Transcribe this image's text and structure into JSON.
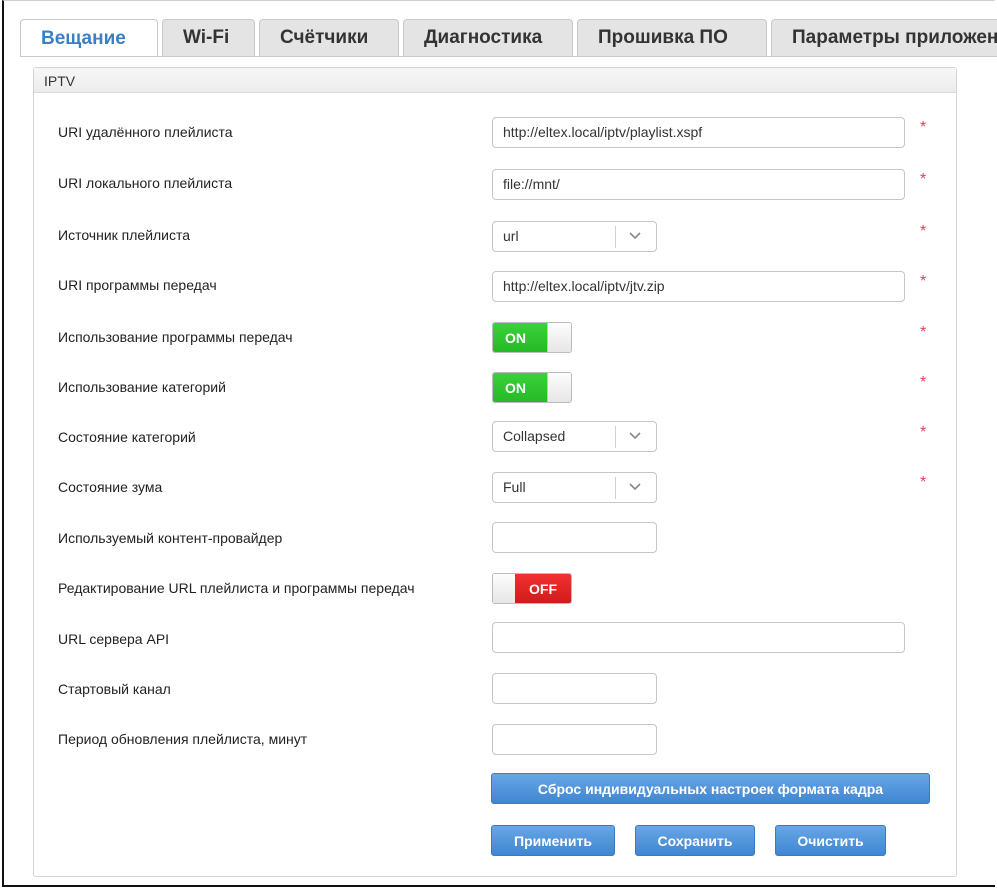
{
  "tabs": [
    "Вещание",
    "Wi-Fi",
    "Счётчики",
    "Диагностика",
    "Прошивка ПО",
    "Параметры приложений"
  ],
  "panel": {
    "title": "IPTV"
  },
  "fields": {
    "remote_playlist": {
      "label": "URI удалённого плейлиста",
      "value": "http://eltex.local/iptv/playlist.xspf"
    },
    "local_playlist": {
      "label": "URI локального плейлиста",
      "value": "file://mnt/"
    },
    "playlist_source": {
      "label": "Источник плейлиста",
      "value": "url"
    },
    "epg_uri": {
      "label": "URI программы передач",
      "value": "http://eltex.local/iptv/jtv.zip"
    },
    "epg_use": {
      "label": "Использование программы передач",
      "state": "ON"
    },
    "categories_use": {
      "label": "Использование категорий",
      "state": "ON"
    },
    "categories_state": {
      "label": "Состояние категорий",
      "value": "Collapsed"
    },
    "zoom_state": {
      "label": "Состояние зума",
      "value": "Full"
    },
    "content_provider": {
      "label": "Используемый контент-провайдер",
      "value": ""
    },
    "edit_urls": {
      "label": "Редактирование URL плейлиста и программы передач",
      "state": "OFF"
    },
    "api_server": {
      "label": "URL сервера API",
      "value": ""
    },
    "start_channel": {
      "label": "Стартовый канал",
      "value": ""
    },
    "refresh_period": {
      "label": "Период обновления плейлиста, минут",
      "value": ""
    }
  },
  "required_mark": "*",
  "buttons": {
    "reset_aspect": "Сброс индивидуальных настроек формата кадра",
    "apply": "Применить",
    "save": "Сохранить",
    "clear": "Очистить"
  },
  "colors": {
    "accent": "#3b7fc4",
    "button": "#4a90d9",
    "toggle_on": "#2ec22e",
    "toggle_off": "#e02424",
    "required": "#e0405a"
  }
}
